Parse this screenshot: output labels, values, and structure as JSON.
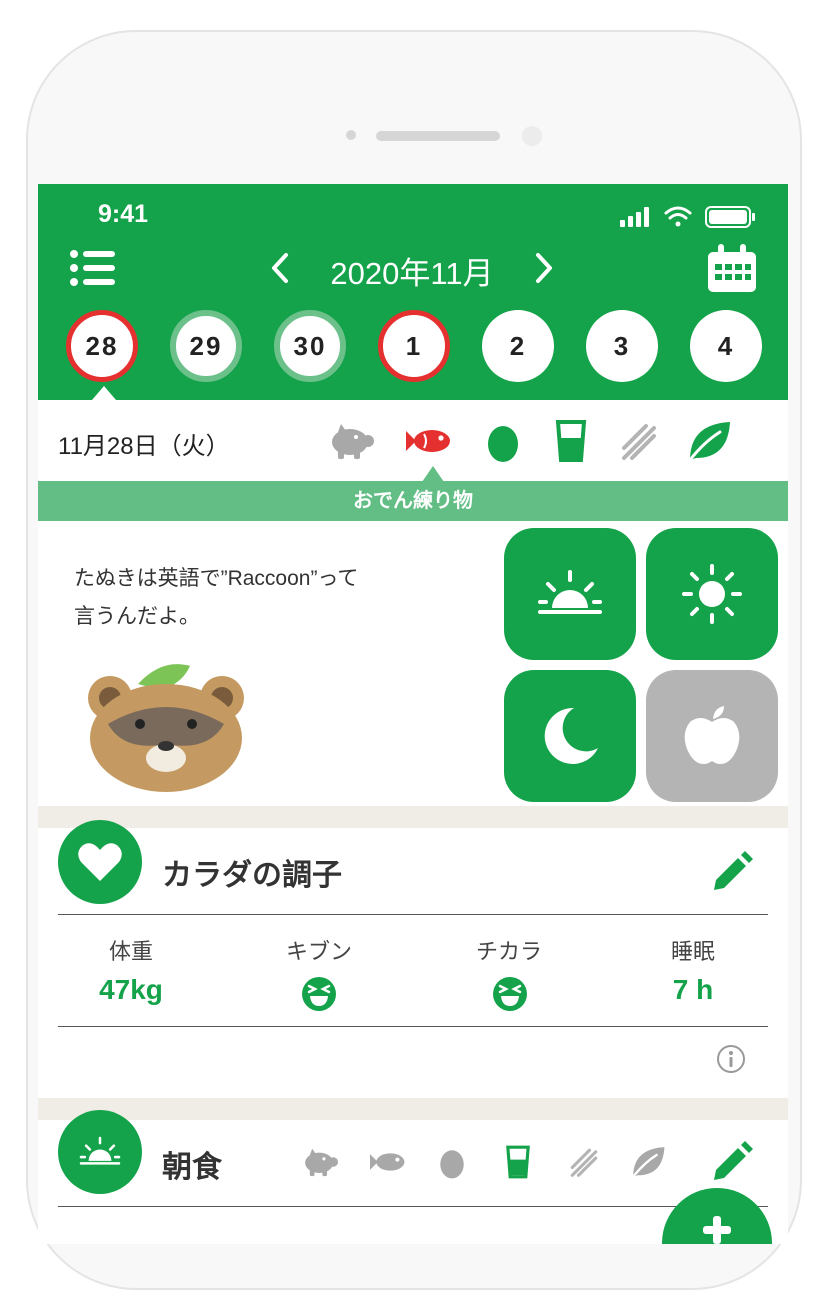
{
  "status_bar": {
    "time": "9:41"
  },
  "header": {
    "month": "2020年11月"
  },
  "days": [
    {
      "label": "28",
      "state": "selected-red"
    },
    {
      "label": "29",
      "state": "logged"
    },
    {
      "label": "30",
      "state": "logged"
    },
    {
      "label": "1",
      "state": "today-red"
    },
    {
      "label": "2",
      "state": "plain"
    },
    {
      "label": "3",
      "state": "plain"
    },
    {
      "label": "4",
      "state": "plain"
    }
  ],
  "date_row": {
    "label": "11月28日（火）",
    "categories": [
      {
        "icon": "pig-icon",
        "active": false
      },
      {
        "icon": "fish-icon",
        "active": true,
        "color": "#e53030"
      },
      {
        "icon": "egg-icon",
        "active": true
      },
      {
        "icon": "milk-glass-icon",
        "active": true
      },
      {
        "icon": "grain-icon",
        "active": false
      },
      {
        "icon": "leaf-icon",
        "active": true
      }
    ]
  },
  "banner": {
    "text": "おでん練り物"
  },
  "message": {
    "line1": "たぬきは英語で”Raccoon”って",
    "line2": "言うんだよ。"
  },
  "meal_buttons": [
    {
      "icon": "sunrise-icon",
      "active": true
    },
    {
      "icon": "sun-icon",
      "active": true
    },
    {
      "icon": "moon-icon",
      "active": true
    },
    {
      "icon": "apple-icon",
      "active": false
    }
  ],
  "body_card": {
    "title": "カラダの調子",
    "stats": [
      {
        "label": "体重",
        "value": "47kg"
      },
      {
        "label": "キブン",
        "value": "",
        "icon": "laughing-face-icon"
      },
      {
        "label": "チカラ",
        "value": "",
        "icon": "laughing-face-icon"
      },
      {
        "label": "睡眠",
        "value": "7 h"
      }
    ]
  },
  "breakfast_card": {
    "title": "朝食",
    "categories": [
      {
        "icon": "pig-icon",
        "active": false
      },
      {
        "icon": "fish-icon",
        "active": false
      },
      {
        "icon": "egg-icon",
        "active": false
      },
      {
        "icon": "milk-glass-icon",
        "active": true
      },
      {
        "icon": "grain-icon",
        "active": false
      },
      {
        "icon": "leaf-icon",
        "active": false
      }
    ]
  },
  "colors": {
    "brand_green": "#14a34a",
    "light_green": "#62be84",
    "alert_red": "#e53030",
    "inactive_grey": "#b4b4b4",
    "separator": "#efede6"
  }
}
